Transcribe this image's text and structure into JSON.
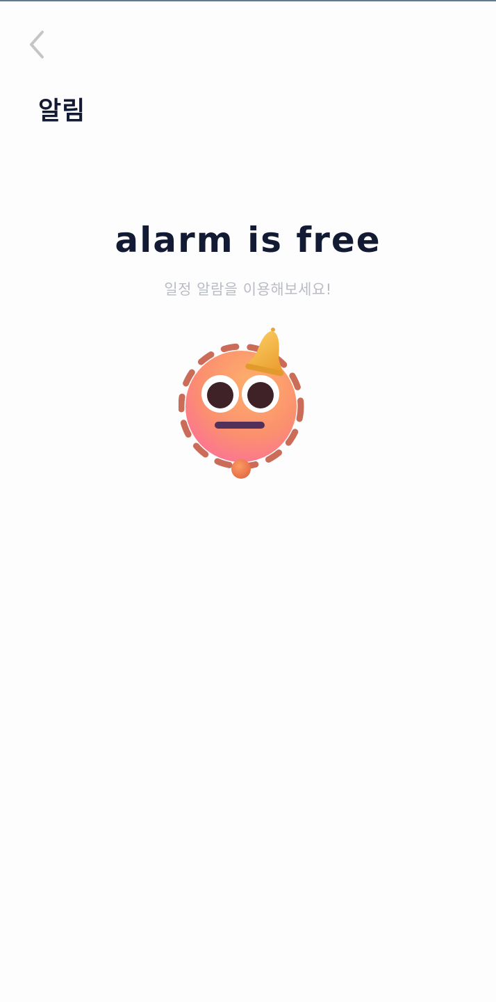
{
  "header": {
    "back_icon": "chevron-left-icon",
    "title": "알림"
  },
  "empty_state": {
    "headline": "alarm is free",
    "subtitle": "일정 알람을 이용해보세요!",
    "illustration_icon": "alarm-bell-face-icon"
  },
  "colors": {
    "background": "#fefdfd",
    "title": "#131a33",
    "headline": "#131a33",
    "subtitle": "#b8bcc4",
    "back_icon": "#c6c6c8",
    "face": "#fb9a6a",
    "bell": "#f6b640"
  }
}
